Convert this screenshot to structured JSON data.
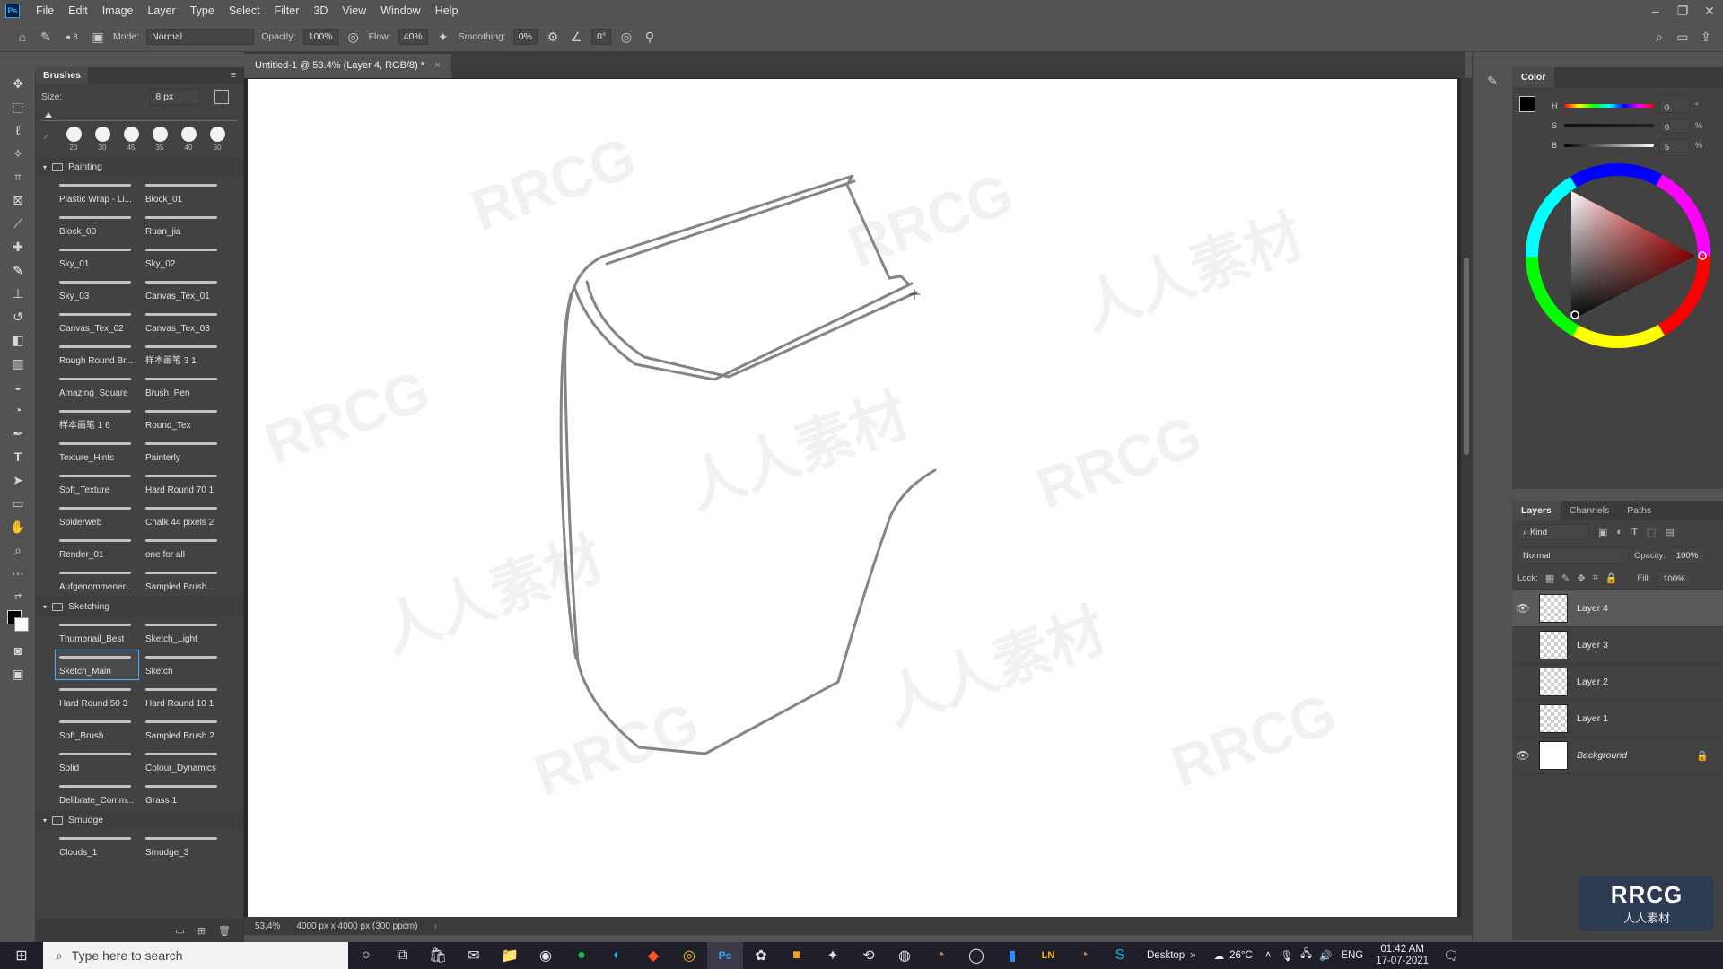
{
  "app": {
    "logo_text": "Ps"
  },
  "menu": [
    "File",
    "Edit",
    "Image",
    "Layer",
    "Type",
    "Select",
    "Filter",
    "3D",
    "View",
    "Window",
    "Help"
  ],
  "window_controls": {
    "minimize": "–",
    "restore": "❐",
    "close": "✕"
  },
  "options": {
    "brush_size": "8",
    "mode_label": "Mode:",
    "mode_value": "Normal",
    "opacity_label": "Opacity:",
    "opacity_value": "100%",
    "flow_label": "Flow:",
    "flow_value": "40%",
    "smoothing_label": "Smoothing:",
    "smoothing_value": "0%",
    "angle_value": "0°"
  },
  "brushes": {
    "tab": "Brushes",
    "size_label": "Size:",
    "size_value": "8 px",
    "tips": [
      "20",
      "30",
      "45",
      "35",
      "40",
      "60"
    ],
    "groups": [
      {
        "name": "Painting",
        "items": [
          "Plastic Wrap - Li...",
          "Block_01",
          "Block_00",
          "Ruan_jia",
          "Sky_01",
          "Sky_02",
          "Sky_03",
          "Canvas_Tex_01",
          "Canvas_Tex_02",
          "Canvas_Tex_03",
          "Rough Round Br...",
          "样本画笔 3 1",
          "Amazing_Square",
          "Brush_Pen",
          "样本画笔 1 6",
          "Round_Tex",
          "Texture_Hints",
          "Painterly",
          "Soft_Texture",
          "Hard Round 70 1",
          "Spiderweb",
          "Chalk 44 pixels 2",
          "Render_01",
          "one for all",
          "Aufgenommener...",
          "Sampled Brush..."
        ]
      },
      {
        "name": "Sketching",
        "items": [
          "Thumbnail_Best",
          "Sketch_Light",
          "Sketch_Main",
          "Sketch",
          "Hard Round 50 3",
          "Hard Round 10 1",
          "Soft_Brush",
          "Sampled Brush 2",
          "Solid",
          "Colour_Dynamics",
          "Delibrate_Comm...",
          "Grass 1"
        ]
      },
      {
        "name": "Smudge",
        "items": [
          "Clouds_1",
          "Smudge_3"
        ]
      }
    ],
    "selected": "Sketch_Main"
  },
  "document": {
    "tab_title": "Untitled-1 @ 53.4% (Layer 4, RGB/8) *",
    "close": "×"
  },
  "status": {
    "zoom": "53.4%",
    "doc_info": "4000 px x 4000 px (300 ppcm)"
  },
  "watermark": {
    "text_a": "RRCG",
    "text_b": "人人素材"
  },
  "color_panel": {
    "tab": "Color",
    "h_label": "H",
    "h_value": "0",
    "h_unit": "°",
    "s_label": "S",
    "s_value": "0",
    "s_unit": "%",
    "b_label": "B",
    "b_value": "5",
    "b_unit": "%"
  },
  "layers_panel": {
    "tabs": [
      "Layers",
      "Channels",
      "Paths"
    ],
    "kind_label": "Kind",
    "blend_mode": "Normal",
    "opacity_label": "Opacity:",
    "opacity_value": "100%",
    "lock_label": "Lock:",
    "fill_label": "Fill:",
    "fill_value": "100%",
    "layers": [
      {
        "name": "Layer 4",
        "visible": true,
        "active": true
      },
      {
        "name": "Layer 3",
        "visible": false,
        "active": false
      },
      {
        "name": "Layer 2",
        "visible": false,
        "active": false
      },
      {
        "name": "Layer 1",
        "visible": false,
        "active": false
      },
      {
        "name": "Background",
        "visible": true,
        "active": false,
        "locked": true
      }
    ]
  },
  "taskbar": {
    "search_placeholder": "Type here to search",
    "desktop_label": "Desktop",
    "temperature": "26°C",
    "language": "ENG",
    "time": "01:42 AM",
    "date": "17-07-2021"
  },
  "brand": {
    "text": "RRCG",
    "sub": "人人素材"
  }
}
